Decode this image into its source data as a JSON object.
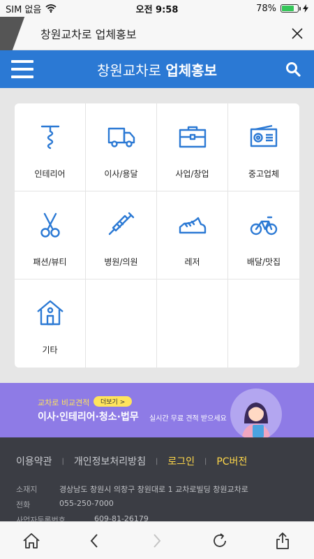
{
  "status_bar": {
    "carrier": "SIM 없음",
    "time": "오전 9:58",
    "battery": "78%",
    "battery_level": 0.78
  },
  "browser_tab": {
    "title": "창원교차로 업체홍보"
  },
  "header": {
    "logo_light": "창원교차로 ",
    "logo_bold": "업체홍보"
  },
  "categories": [
    {
      "label": "인테리어",
      "icon": "corkscrew-icon"
    },
    {
      "label": "이사/용달",
      "icon": "truck-icon"
    },
    {
      "label": "사업/창업",
      "icon": "briefcase-icon"
    },
    {
      "label": "중고업체",
      "icon": "radio-icon"
    },
    {
      "label": "패션/뷰티",
      "icon": "scissors-icon"
    },
    {
      "label": "병원/의원",
      "icon": "syringe-icon"
    },
    {
      "label": "레저",
      "icon": "shoe-icon"
    },
    {
      "label": "배달/맛집",
      "icon": "bicycle-icon"
    },
    {
      "label": "기타",
      "icon": "house-icon"
    }
  ],
  "banner": {
    "small": "교차로 비교견적",
    "more": "더보기 >",
    "headline": "이사·인테리어·청소·법무",
    "sub": "실시간 무료 견적 받으세요"
  },
  "footer": {
    "links": [
      "이용약관",
      "개인정보처리방침",
      "로그인",
      "PC버전"
    ],
    "address_label": "소재지",
    "address": "경상남도 창원시 의창구 창원대로 1 교차로빌딩 창원교차로",
    "phone_label": "전화",
    "phone": "055-250-7000",
    "biz_label": "사업자등록번호",
    "biz": "609-81-26179"
  },
  "colors": {
    "brand": "#2b79d4",
    "banner": "#8e7be6",
    "footer": "#3b3d44",
    "highlight": "#ffd84a"
  }
}
